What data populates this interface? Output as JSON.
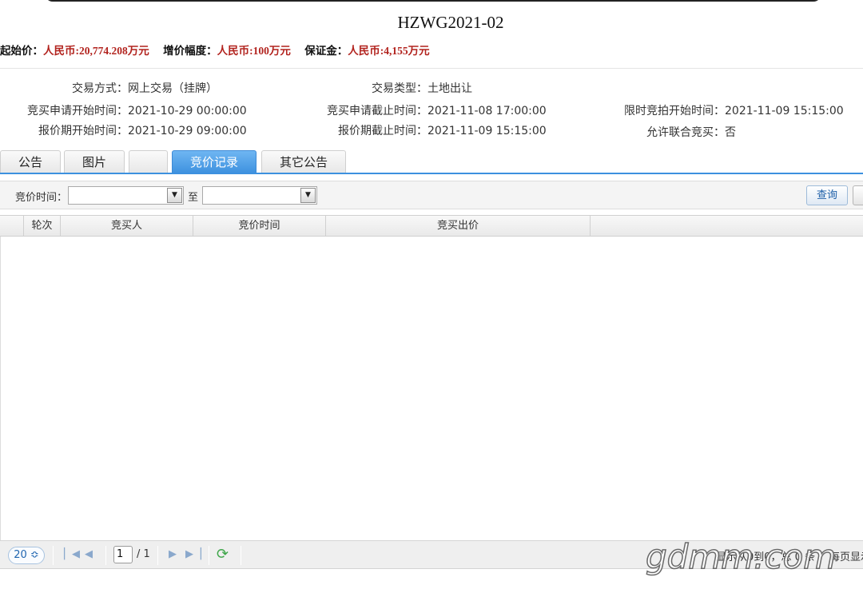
{
  "title": "HZWG2021-02",
  "price": {
    "start_label": "起始价：",
    "start_value": "人民币:20,774.208万元",
    "inc_label": "增价幅度：",
    "inc_value": "人民币:100万元",
    "deposit_label": "保证金：",
    "deposit_value": "人民币:4,155万元"
  },
  "info": {
    "trade_mode_k": "交易方式：",
    "trade_mode_v": "网上交易（挂牌）",
    "trade_type_k": "交易类型：",
    "trade_type_v": "土地出让",
    "apply_start_k": "竞买申请开始时间：",
    "apply_start_v": "2021-10-29 00:00:00",
    "apply_end_k": "竞买申请截止时间：",
    "apply_end_v": "2021-11-08 17:00:00",
    "auction_start_k": "限时竞拍开始时间：",
    "auction_start_v": "2021-11-09 15:15:00",
    "quote_start_k": "报价期开始时间：",
    "quote_start_v": "2021-10-29 09:00:00",
    "quote_end_k": "报价期截止时间：",
    "quote_end_v": "2021-11-09 15:15:00",
    "joint_k": "允许联合竞买：",
    "joint_v": "否"
  },
  "tabs": [
    "公告",
    "图片",
    "",
    "竞价记录",
    "其它公告"
  ],
  "search": {
    "time_label": "竞价时间：",
    "to_label": "至",
    "from_value": "",
    "to_value": "",
    "query_label": "查询"
  },
  "grid": {
    "columns": [
      "轮次",
      "竞买人",
      "竞价时间",
      "竞买出价"
    ]
  },
  "pager": {
    "page_size": "20 ≎",
    "page": "1",
    "total": "/ 1",
    "info": "显示从0到0，总 0 条",
    "per_page": "每页显示"
  },
  "watermark": "gdmm.com"
}
